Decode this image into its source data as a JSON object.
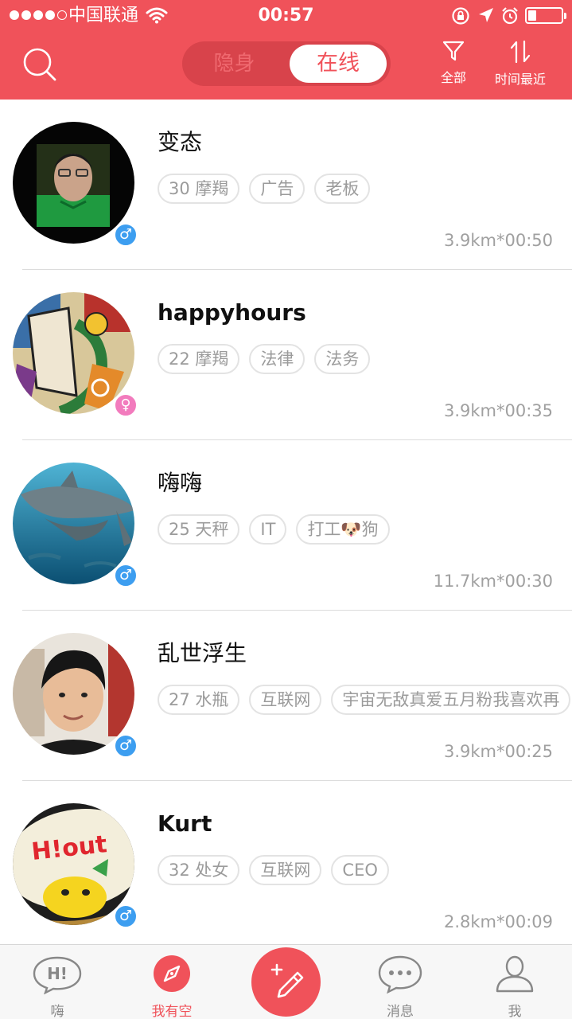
{
  "status_bar": {
    "carrier": "中国联通",
    "time": "00:57",
    "signal_icon": "signal-dots-icon",
    "wifi_icon": "wifi-icon",
    "battery_icon": "battery-icon"
  },
  "header": {
    "search_icon": "search-icon",
    "toggle": {
      "hidden_label": "隐身",
      "online_label": "在线",
      "selected": "在线"
    },
    "filter": {
      "label": "全部",
      "icon": "filter-icon"
    },
    "sort": {
      "label": "时间最近",
      "icon": "sort-icon"
    }
  },
  "users": [
    {
      "name": "变态",
      "gender": "male",
      "gender_symbol": "♂",
      "tags": [
        "30 摩羯",
        "广告",
        "老板"
      ],
      "meta": "3.9km*00:50"
    },
    {
      "name": "happyhours",
      "gender": "female",
      "gender_symbol": "♀",
      "tags": [
        "22 摩羯",
        "法律",
        "法务"
      ],
      "meta": "3.9km*00:35"
    },
    {
      "name": "嗨嗨",
      "gender": "male",
      "gender_symbol": "♂",
      "tags": [
        "25 天秤",
        "IT",
        "打工🐶狗"
      ],
      "meta": "11.7km*00:30"
    },
    {
      "name": "乱世浮生",
      "gender": "male",
      "gender_symbol": "♂",
      "tags": [
        "27 水瓶",
        "互联网",
        "宇宙无敌真爱五月粉我喜欢再"
      ],
      "meta": "3.9km*00:25"
    },
    {
      "name": "Kurt",
      "gender": "male",
      "gender_symbol": "♂",
      "tags": [
        "32 处女",
        "互联网",
        "CEO"
      ],
      "meta": "2.8km*00:09",
      "avatar_text": "H!out"
    }
  ],
  "tabbar": {
    "tabs": [
      {
        "label": "嗨",
        "icon": "hi-bubble-icon",
        "active": false
      },
      {
        "label": "我有空",
        "icon": "compass-icon",
        "active": true
      },
      {
        "label": "消息",
        "icon": "chat-bubble-icon",
        "active": false
      },
      {
        "label": "我",
        "icon": "person-icon",
        "active": false
      }
    ],
    "compose_icon": "compose-pencil-icon",
    "hi_icon_text": "H!"
  },
  "colors": {
    "brand_red": "#f0525a",
    "male_blue": "#3d9ef0",
    "female_pink": "#f27bbd"
  }
}
